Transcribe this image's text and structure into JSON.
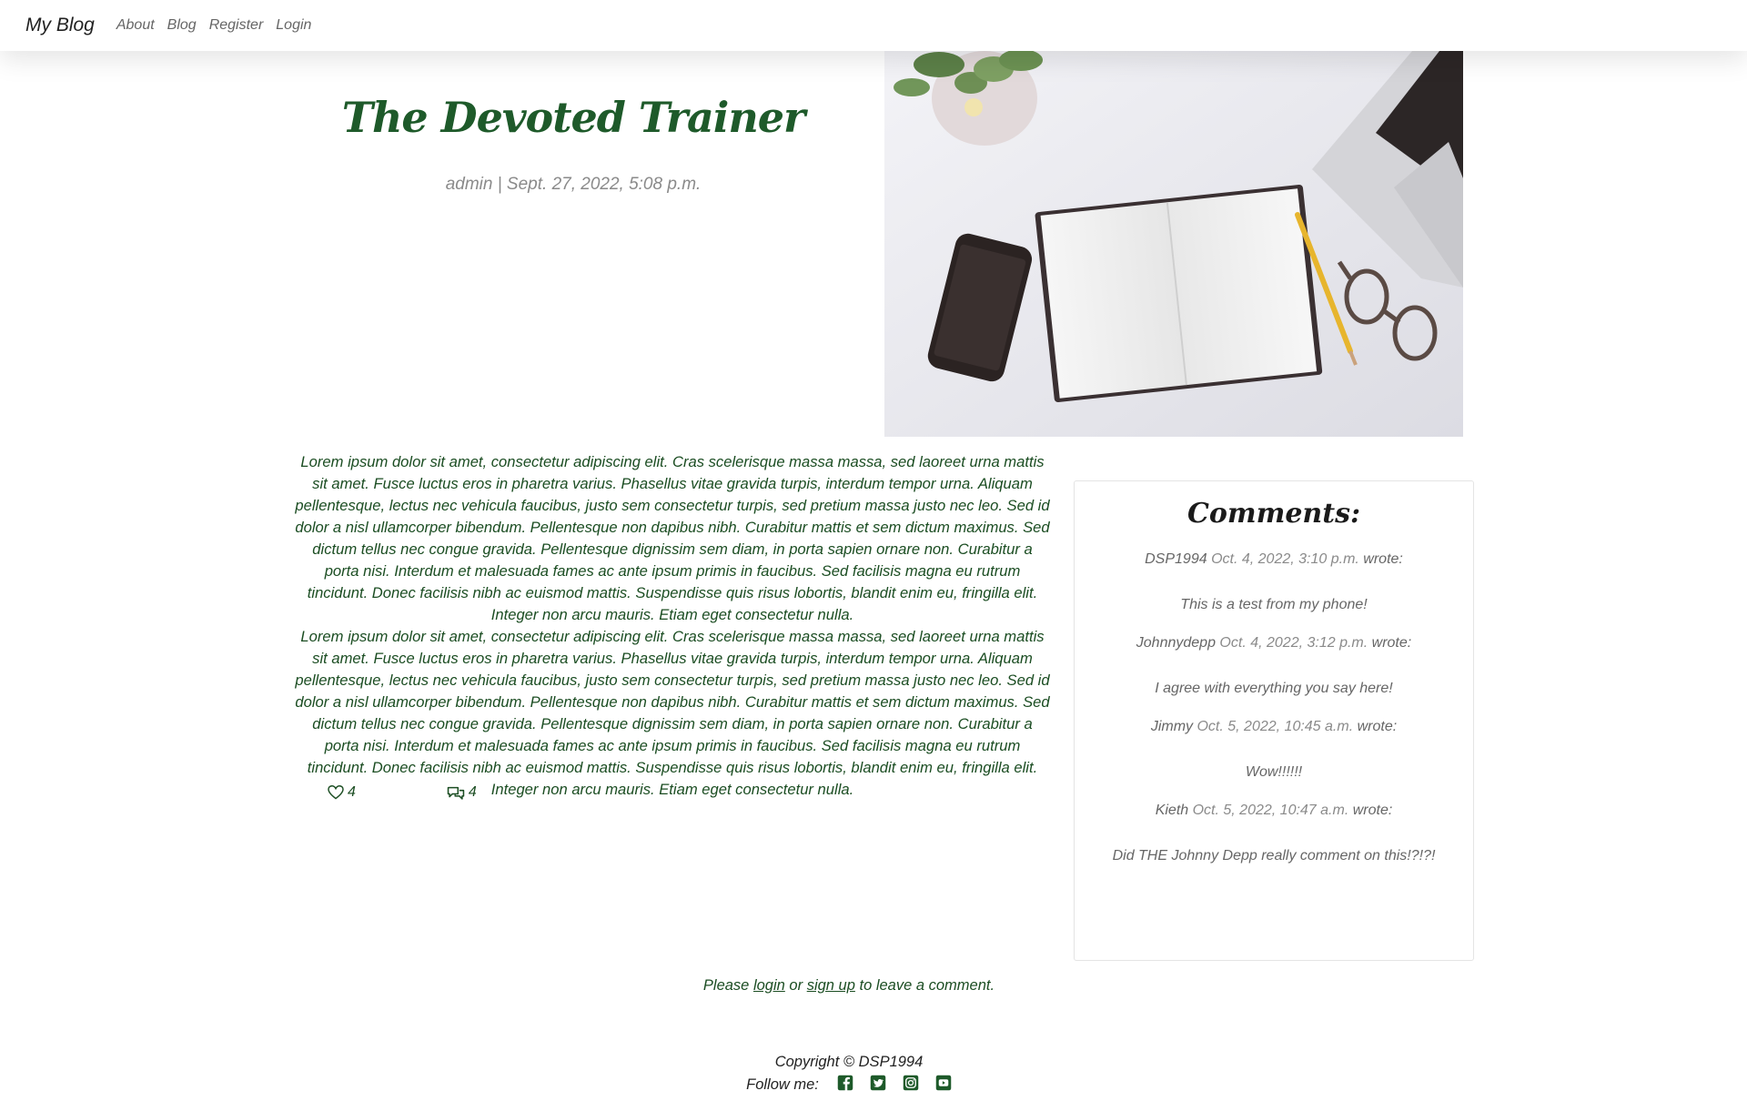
{
  "nav": {
    "brand": "My Blog",
    "links": [
      "About",
      "Blog",
      "Register",
      "Login"
    ]
  },
  "post": {
    "title": "The Devoted Trainer",
    "meta": "admin | Sept. 27, 2022, 5:08 p.m.",
    "paragraph_1": "Lorem ipsum dolor sit amet, consectetur adipiscing elit. Cras scelerisque massa massa, sed laoreet urna mattis sit amet. Fusce luctus eros in pharetra varius. Phasellus vitae gravida turpis, interdum tempor urna. Aliquam pellentesque, lectus nec vehicula faucibus, justo sem consectetur turpis, sed pretium massa justo nec leo. Sed id dolor a nisl ullamcorper bibendum. Pellentesque non dapibus nibh. Curabitur mattis et sem dictum maximus. Sed dictum tellus nec congue gravida. Pellentesque dignissim sem diam, in porta sapien ornare non. Curabitur a porta nisi. Interdum et malesuada fames ac ante ipsum primis in faucibus. Sed facilisis magna eu rutrum tincidunt. Donec facilisis nibh ac euismod mattis. Suspendisse quis risus lobortis, blandit enim eu, fringilla elit. Integer non arcu mauris. Etiam eget consectetur nulla.",
    "paragraph_2": "Lorem ipsum dolor sit amet, consectetur adipiscing elit. Cras scelerisque massa massa, sed laoreet urna mattis sit amet. Fusce luctus eros in pharetra varius. Phasellus vitae gravida turpis, interdum tempor urna. Aliquam pellentesque, lectus nec vehicula faucibus, justo sem consectetur turpis, sed pretium massa justo nec leo. Sed id dolor a nisl ullamcorper bibendum. Pellentesque non dapibus nibh. Curabitur mattis et sem dictum maximus. Sed dictum tellus nec congue gravida. Pellentesque dignissim sem diam, in porta sapien ornare non. Curabitur a porta nisi. Interdum et malesuada fames ac ante ipsum primis in faucibus. Sed facilisis magna eu rutrum tincidunt. Donec facilisis nibh ac euismod mattis. Suspendisse quis risus lobortis, blandit enim eu, fringilla elit. Integer non arcu mauris. Etiam eget consectetur nulla.",
    "likes": "4",
    "comment_count": "4"
  },
  "comments": {
    "title": "Comments:",
    "wrote": "wrote:",
    "items": [
      {
        "author": "DSP1994",
        "date": "Oct. 4, 2022, 3:10 p.m.",
        "body": "This is a test from my phone!"
      },
      {
        "author": "Johnnydepp",
        "date": "Oct. 4, 2022, 3:12 p.m.",
        "body": "I agree with everything you say here!"
      },
      {
        "author": "Jimmy",
        "date": "Oct. 5, 2022, 10:45 a.m.",
        "body": "Wow!!!!!!"
      },
      {
        "author": "Kieth",
        "date": "Oct. 5, 2022, 10:47 a.m.",
        "body": "Did THE Johnny Depp really comment on this!?!?!"
      }
    ]
  },
  "login_prompt": {
    "prefix": "Please",
    "login": "login",
    "middle": "or",
    "signup": "sign up",
    "suffix": "to leave a comment."
  },
  "footer": {
    "copyright": "Copyright © DSP1994",
    "follow": "Follow me:",
    "social_icons": [
      "facebook-icon",
      "twitter-icon",
      "instagram-icon",
      "youtube-icon"
    ]
  },
  "colors": {
    "accent_green": "#1e5a2a",
    "text_green": "#1b4d22",
    "muted": "#8a8a8a"
  }
}
